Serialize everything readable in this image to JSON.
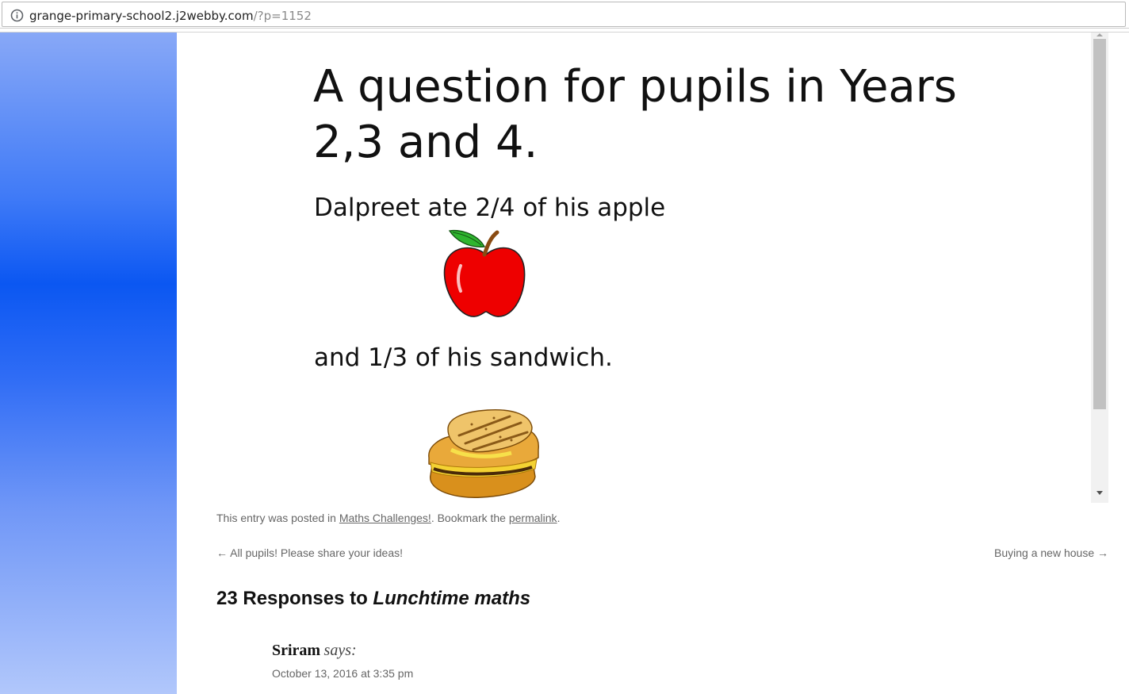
{
  "browser": {
    "url_host": "grange-primary-school2.j2webby.com",
    "url_path": "/?p=1152"
  },
  "post": {
    "heading": "A question for pupils in Years 2,3 and 4.",
    "line1": "Dalpreet ate 2/4 of his apple",
    "line2": "and 1/3 of his sandwich."
  },
  "meta": {
    "prefix": "This entry was posted in ",
    "category": "Maths Challenges!",
    "middle": ". Bookmark the ",
    "permalink": "permalink",
    "suffix": "."
  },
  "nav": {
    "prev": "← All pupils! Please share your ideas!",
    "next": "Buying a new house →"
  },
  "comments": {
    "title_prefix": "23 Responses to ",
    "title_post": "Lunchtime maths",
    "first": {
      "author": "Sriram",
      "says": "says:",
      "date": "October 13, 2016 at 3:35 pm"
    }
  }
}
